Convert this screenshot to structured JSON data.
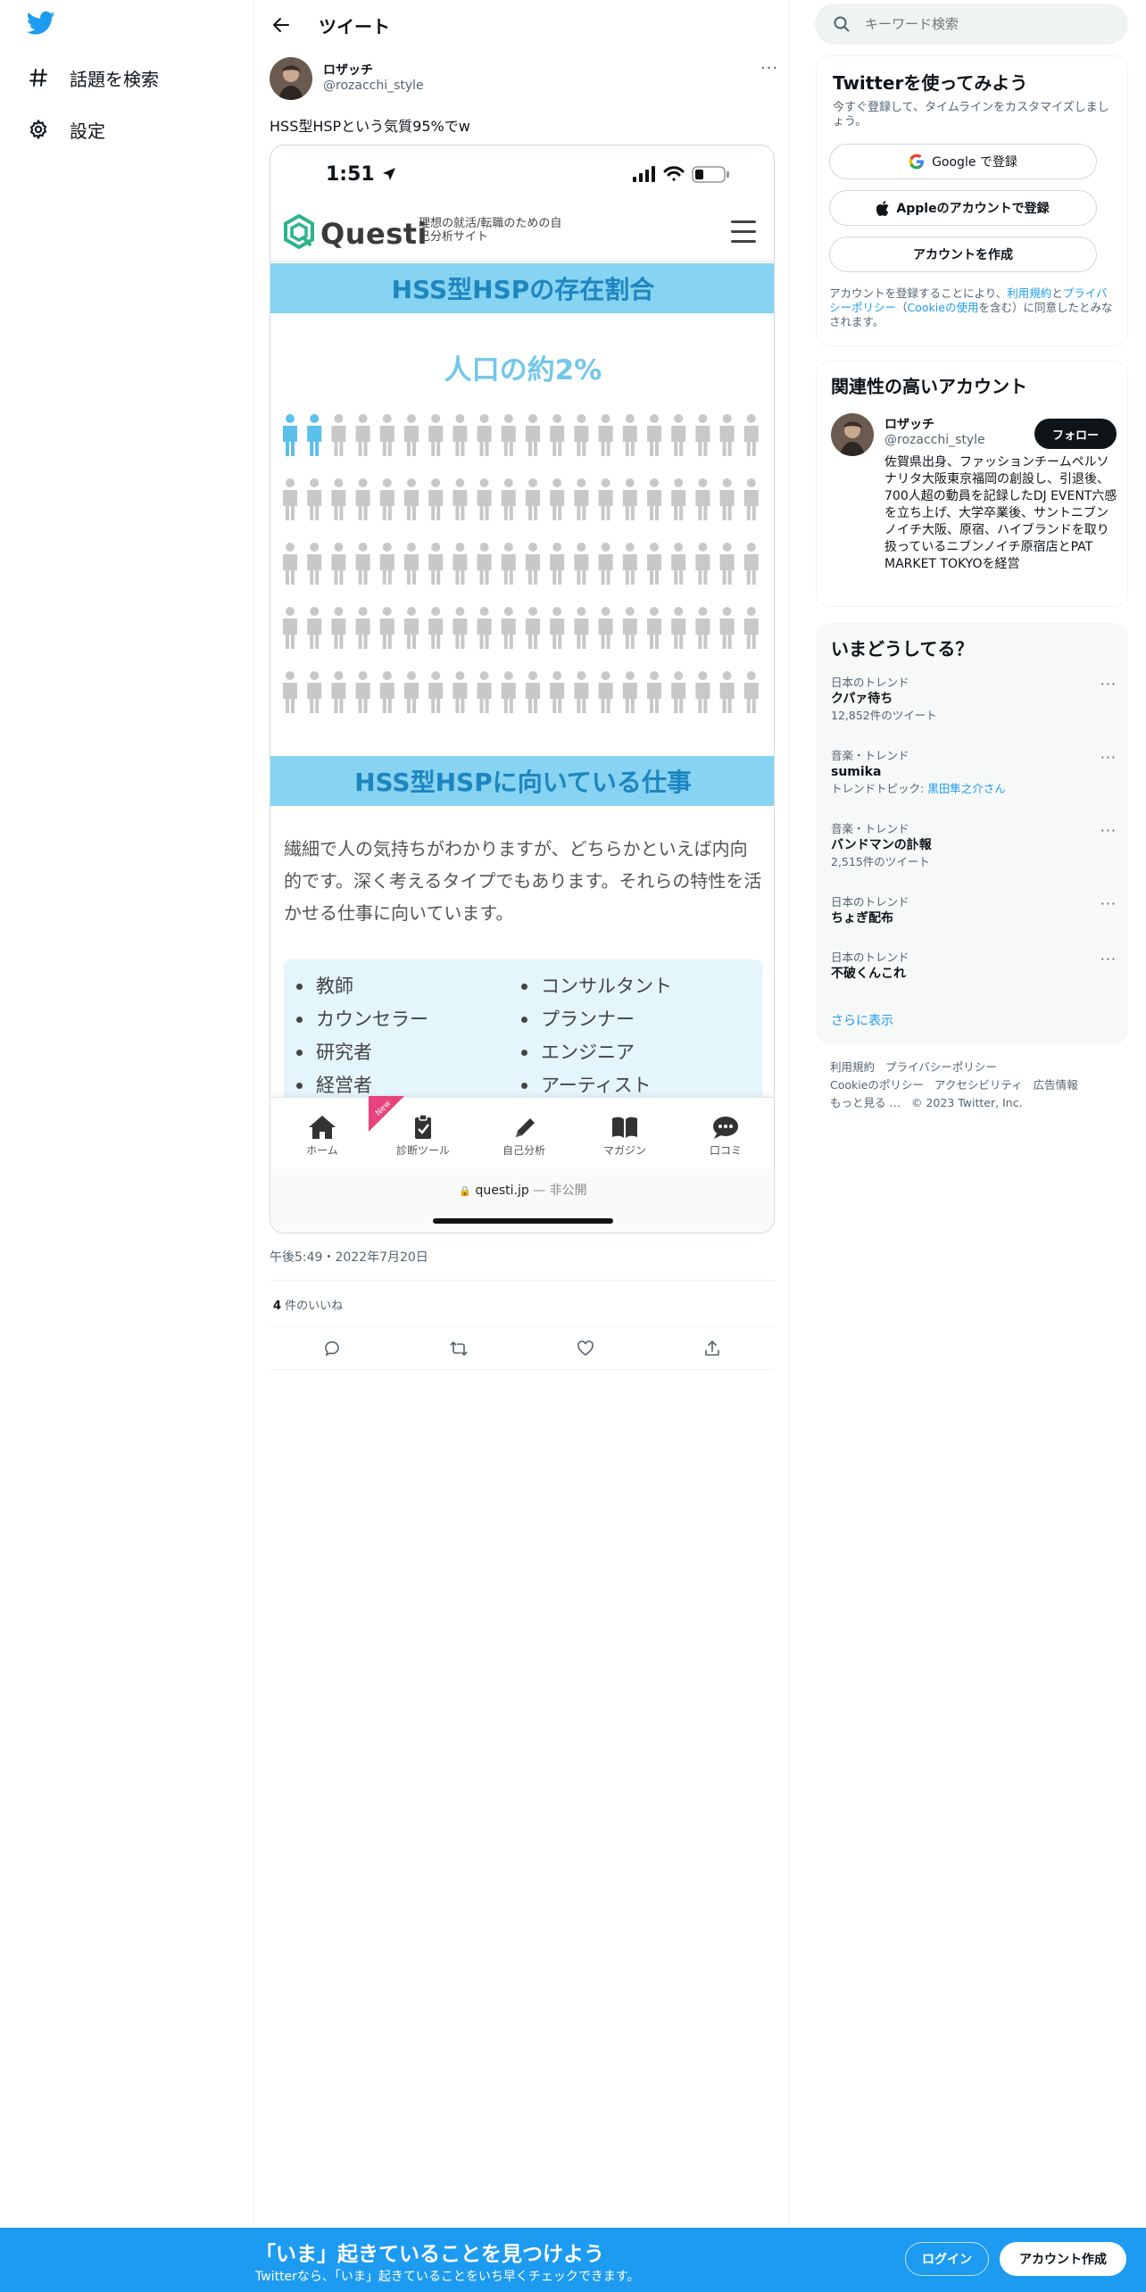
{
  "colors": {
    "twitter_blue": "#1d9bf0",
    "band_blue": "#87d3f2",
    "band_text": "#1d86c0",
    "person_highlight": "#5bc0ea",
    "person_gray": "#c8c8c8",
    "questi_green": "#2bb38a"
  },
  "nav": {
    "logo_icon": "twitter-bird-icon",
    "items": [
      {
        "label": "話題を検索",
        "icon": "hashtag-icon"
      },
      {
        "label": "設定",
        "icon": "gear-icon"
      }
    ]
  },
  "header": {
    "title": "ツイート",
    "back_icon": "arrow-left-icon"
  },
  "tweet": {
    "author_name": "ロザッチ",
    "author_handle": "@rozacchi_style",
    "text": "HSS型HSPという気質95%でw",
    "timestamp": "午後5:49・2022年7月20日",
    "likes_count": "4",
    "likes_label": " 件のいいね"
  },
  "screenshot": {
    "status_time": "1:51",
    "brand_name": "Questi",
    "brand_tagline": "理想の就活/転職のための自己分析サイト",
    "section1_title": "HSS型HSPの存在割合",
    "ratio_text": "人口の約2%",
    "people_highlighted": 2,
    "people_total": 100,
    "section2_title": "HSS型HSPに向いている仕事",
    "jobs_description": "繊細で人の気持ちがわかりますが、どちらかといえば内向的です。深く考えるタイプでもあります。それらの特性を活かせる仕事に向いています。",
    "jobs_left": [
      "教師",
      "カウンセラー",
      "研究者",
      "経営者"
    ],
    "jobs_right": [
      "コンサルタント",
      "プランナー",
      "エンジニア",
      "アーティスト"
    ],
    "tabs": [
      {
        "label": "ホーム",
        "icon": "home-icon"
      },
      {
        "label": "診断ツール",
        "icon": "clipboard-check-icon"
      },
      {
        "label": "自己分析",
        "icon": "pencil-icon"
      },
      {
        "label": "マガジン",
        "icon": "book-icon"
      },
      {
        "label": "口コミ",
        "icon": "chat-bubble-icon"
      }
    ],
    "new_badge": "New",
    "url": "questi.jp",
    "url_suffix": " — 非公開"
  },
  "search": {
    "placeholder": "キーワード検索"
  },
  "signup": {
    "title": "Twitterを使ってみよう",
    "subtitle": "今すぐ登録して、タイムラインをカスタマイズしましょう。",
    "google_btn": "Google で登録",
    "apple_btn": "Appleのアカウントで登録",
    "create_btn": "アカウントを作成",
    "legal_prefix": "アカウントを登録することにより、",
    "legal_terms": "利用規約",
    "legal_and": "と",
    "legal_privacy": "プライバシーポリシー",
    "legal_paren_open": "（",
    "legal_cookie": "Cookieの使用",
    "legal_suffix": "を含む）に同意したとみなされます。"
  },
  "related": {
    "title": "関連性の高いアカウント",
    "name": "ロザッチ",
    "handle": "@rozacchi_style",
    "follow_btn": "フォロー",
    "bio": "佐賀県出身、ファッションチームペルソナリタ大阪東京福岡の創設し、引退後、700人超の動員を記録したDJ EVENT六感を立ち上げ、大学卒業後、サントニブンノイチ大阪、原宿、ハイブランドを取り扱っているニブンノイチ原宿店とPAT MARKET TOKYOを経営"
  },
  "trends": {
    "title": "いまどうしてる？",
    "items": [
      {
        "context": "日本のトレンド",
        "name": "クパァ待ち",
        "meta": "12,852件のツイート",
        "meta_link": ""
      },
      {
        "context": "音楽・トレンド",
        "name": "sumika",
        "meta": "トレンドトピック: ",
        "meta_link": "黒田隼之介さん"
      },
      {
        "context": "音楽・トレンド",
        "name": "バンドマンの訃報",
        "meta": "2,515件のツイート",
        "meta_link": ""
      },
      {
        "context": "日本のトレンド",
        "name": "ちょぎ配布",
        "meta": "",
        "meta_link": ""
      },
      {
        "context": "日本のトレンド",
        "name": "不破くんこれ",
        "meta": "",
        "meta_link": ""
      }
    ],
    "show_more": "さらに表示"
  },
  "footer": {
    "links": [
      "利用規約",
      "プライバシーポリシー",
      "Cookieのポリシー",
      "アクセシビリティ",
      "広告情報",
      "もっと見る …",
      "© 2023 Twitter, Inc."
    ]
  },
  "bottom_bar": {
    "title": "「いま」起きていることを見つけよう",
    "subtitle": "Twitterなら、「いま」起きていることをいち早くチェックできます。",
    "login_btn": "ログイン",
    "signup_btn": "アカウント作成"
  }
}
